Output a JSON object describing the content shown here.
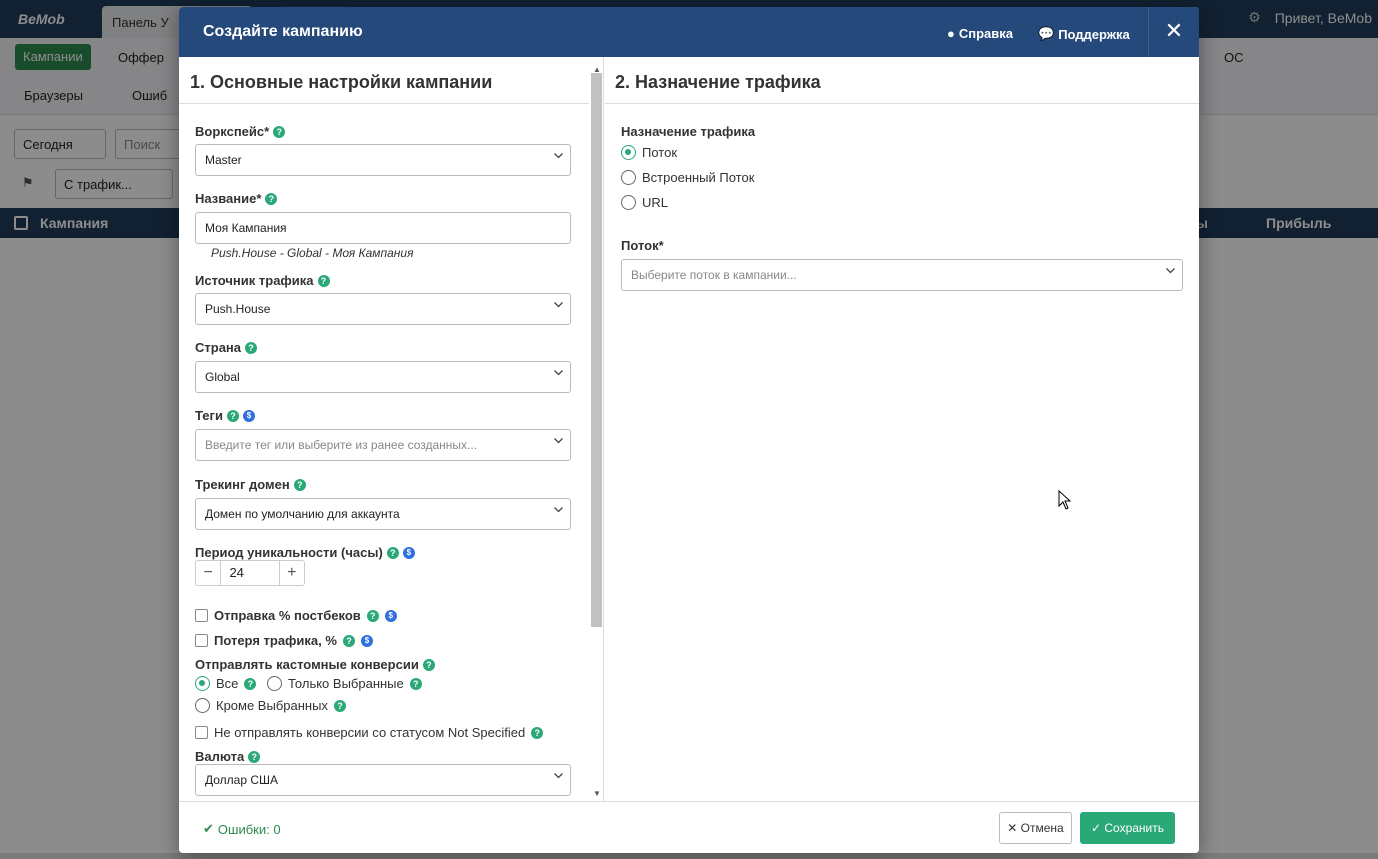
{
  "bg": {
    "logo": "BeMob",
    "tab_label": "Панель У",
    "greeting": "Привет, BeMob",
    "campaigns_btn": "Кампании",
    "offers": "Оффер",
    "os": "ОС",
    "browsers": "Браузеры",
    "errors_tab": "Ошиб",
    "today": "Сегодня",
    "search_placeholder": "Поиск",
    "traffic_filter": "С трафик...",
    "badge": "5",
    "col_campaign": "Кампания",
    "col_partial": "ы",
    "col_profit": "Прибыль"
  },
  "modal": {
    "title": "Создайте кампанию",
    "help": "Справка",
    "support": "Поддержка",
    "close": "✕"
  },
  "left": {
    "section_title": "1. Основные настройки кампании",
    "workspace_label": "Воркспейс*",
    "workspace_value": "Master",
    "name_label": "Название*",
    "name_value": "Моя Кампания",
    "name_hint": "Push.House - Global - Моя Кампания",
    "source_label": "Источник трафика",
    "source_value": "Push.House",
    "country_label": "Страна",
    "country_value": "Global",
    "tags_label": "Теги",
    "tags_placeholder": "Введите тег или выберите из ранее созданных...",
    "domain_label": "Трекинг домен",
    "domain_value": "Домен по умолчанию для аккаунта",
    "period_label": "Период уникальности (часы)",
    "period_value": "24",
    "postback_label": "Отправка % постбеков",
    "loss_label": "Потеря трафика, %",
    "custom_conv_label": "Отправлять кастомные конверсии",
    "radio_all": "Все",
    "radio_selected": "Только Выбранные",
    "radio_except": "Кроме Выбранных",
    "not_specified_label": "Не отправлять конверсии со статусом Not Specified",
    "currency_label": "Валюта",
    "currency_value": "Доллар США"
  },
  "right": {
    "section_title": "2. Назначение трафика",
    "dest_label": "Назначение трафика",
    "opt_flow": "Поток",
    "opt_builtin": "Встроенный Поток",
    "opt_url": "URL",
    "flow_label": "Поток*",
    "flow_placeholder": "Выберите поток в кампании..."
  },
  "footer": {
    "errors": "Ошибки: 0",
    "cancel": "Отмена",
    "save": "Сохранить"
  },
  "colors": {
    "header": "#24497a",
    "accent": "#2aa877",
    "info": "#2f6fe0"
  }
}
